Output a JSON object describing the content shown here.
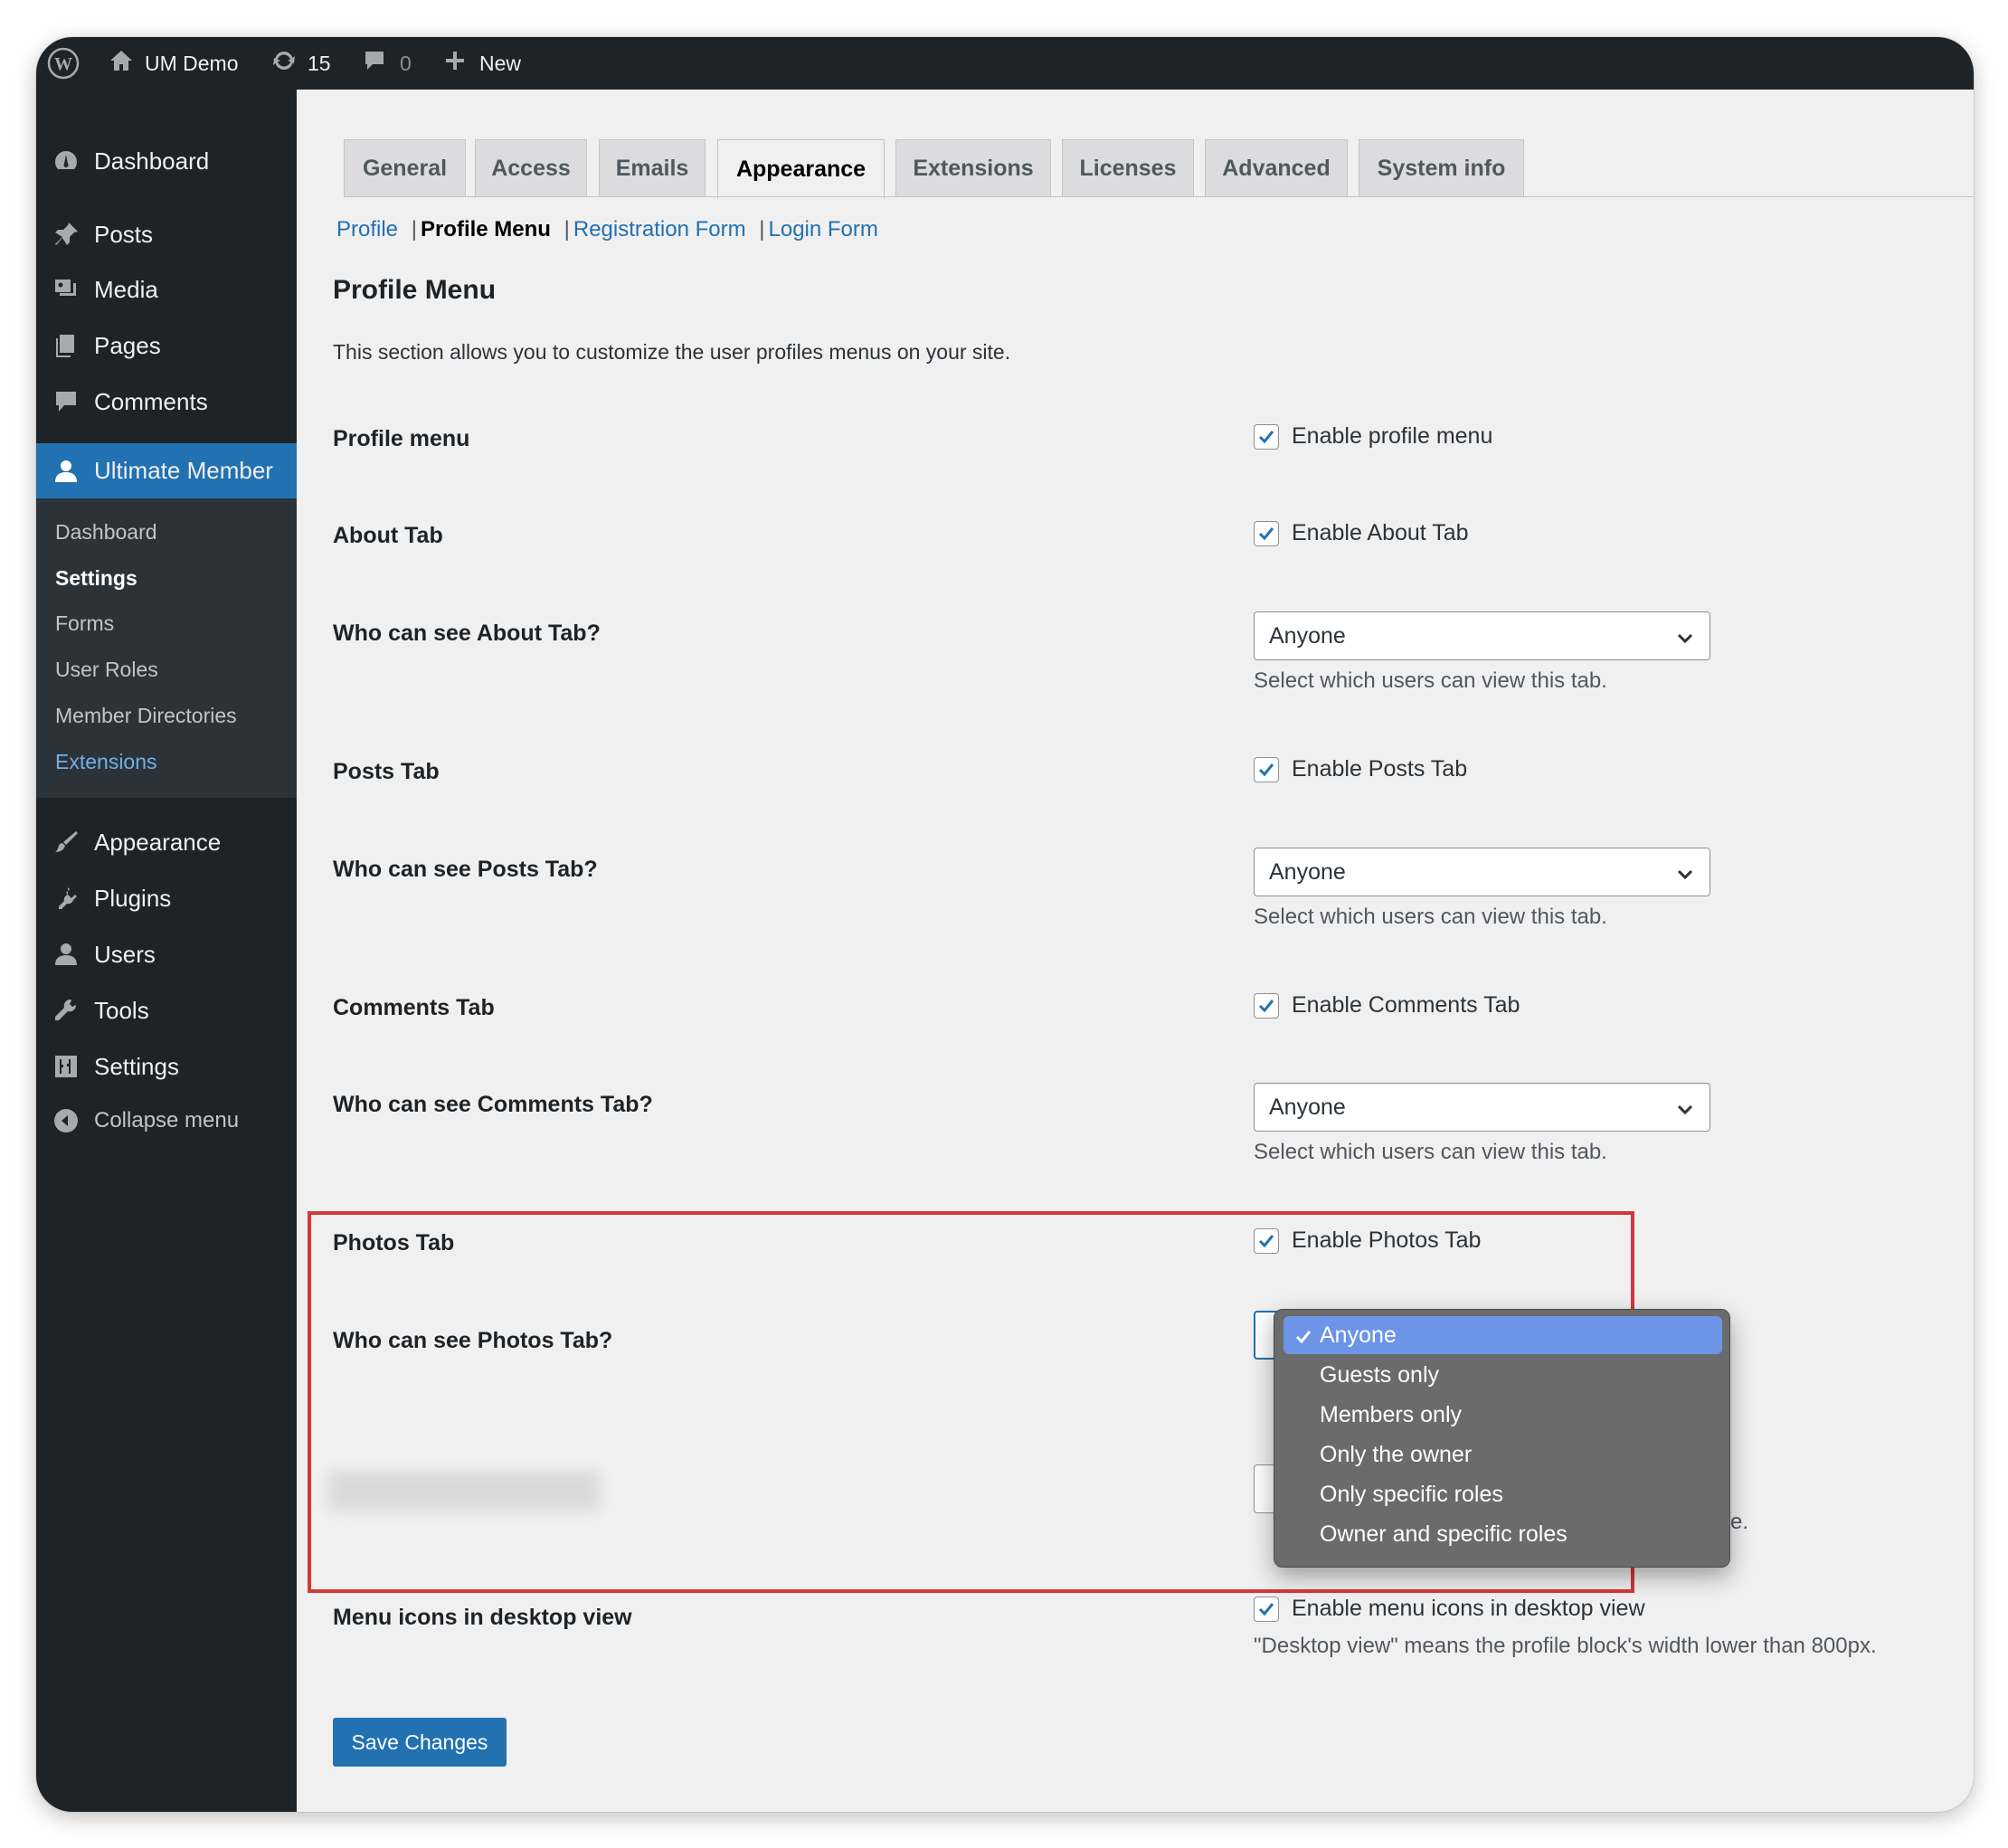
{
  "admin_bar": {
    "site_name": "UM Demo",
    "updates_count": "15",
    "comments_count": "0",
    "new_label": "New"
  },
  "sidebar": {
    "items": [
      {
        "label": "Dashboard",
        "icon": "dashboard-icon"
      },
      {
        "label": "Posts",
        "icon": "pin-icon"
      },
      {
        "label": "Media",
        "icon": "media-icon"
      },
      {
        "label": "Pages",
        "icon": "pages-icon"
      },
      {
        "label": "Comments",
        "icon": "comment-icon"
      },
      {
        "label": "Ultimate Member",
        "icon": "user-icon"
      },
      {
        "label": "Appearance",
        "icon": "brush-icon"
      },
      {
        "label": "Plugins",
        "icon": "plugin-icon"
      },
      {
        "label": "Users",
        "icon": "users-icon"
      },
      {
        "label": "Tools",
        "icon": "wrench-icon"
      },
      {
        "label": "Settings",
        "icon": "sliders-icon"
      }
    ],
    "submenu": [
      "Dashboard",
      "Settings",
      "Forms",
      "User Roles",
      "Member Directories",
      "Extensions"
    ],
    "collapse_label": "Collapse menu"
  },
  "tabs": [
    "General",
    "Access",
    "Emails",
    "Appearance",
    "Extensions",
    "Licenses",
    "Advanced",
    "System info"
  ],
  "subnav": {
    "profile": "Profile",
    "profile_menu": "Profile Menu",
    "registration_form": "Registration Form",
    "login_form": "Login Form",
    "separator": "|"
  },
  "section": {
    "title": "Profile Menu",
    "description": "This section allows you to customize the user profiles menus on your site."
  },
  "fields": {
    "profile_menu": {
      "label": "Profile menu",
      "checkbox": "Enable profile menu"
    },
    "about_tab": {
      "label": "About Tab",
      "checkbox": "Enable About Tab"
    },
    "about_who": {
      "label": "Who can see About Tab?",
      "value": "Anyone",
      "help": "Select which users can view this tab."
    },
    "posts_tab": {
      "label": "Posts Tab",
      "checkbox": "Enable Posts Tab"
    },
    "posts_who": {
      "label": "Who can see Posts Tab?",
      "value": "Anyone",
      "help": "Select which users can view this tab."
    },
    "comments_tab": {
      "label": "Comments Tab",
      "checkbox": "Enable Comments Tab"
    },
    "comments_who": {
      "label": "Who can see Comments Tab?",
      "value": "Anyone",
      "help": "Select which users can view this tab."
    },
    "photos_tab": {
      "label": "Photos Tab",
      "checkbox": "Enable Photos Tab"
    },
    "photos_who": {
      "label": "Who can see Photos Tab?"
    },
    "partial_help": "page.",
    "menu_icons": {
      "label": "Menu icons in desktop view",
      "checkbox": "Enable menu icons in desktop view",
      "help": "\"Desktop view\" means the profile block's width lower than 800px."
    }
  },
  "dropdown": {
    "options": [
      "Anyone",
      "Guests only",
      "Members only",
      "Only the owner",
      "Only specific roles",
      "Owner and specific roles"
    ],
    "selected": "Anyone"
  },
  "save_button": "Save Changes",
  "colors": {
    "accent": "#2271b1",
    "highlight_border": "#d63638",
    "sidebar_bg": "#1d2327",
    "dropdown_selected": "#6c95e8"
  }
}
